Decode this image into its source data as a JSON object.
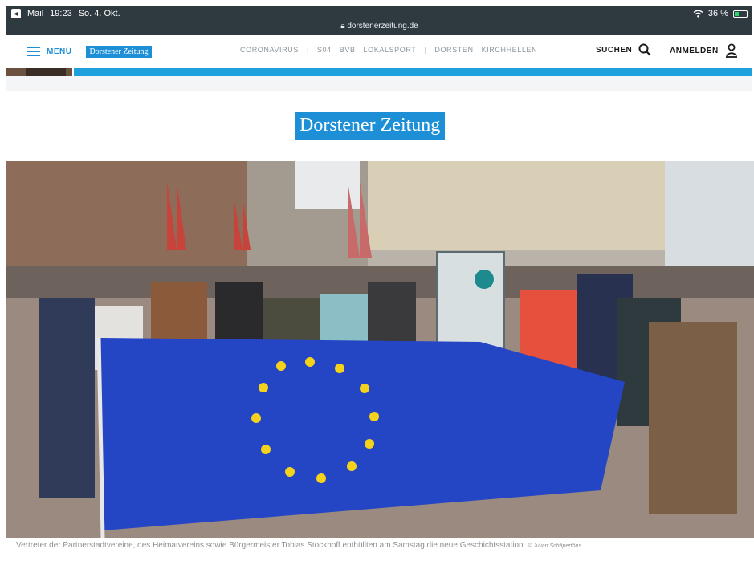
{
  "statusbar": {
    "app_back": "Mail",
    "time": "19:23",
    "date": "So. 4. Okt.",
    "url": "dorstenerzeitung.de",
    "battery": "36 %",
    "battery_level": 0.36
  },
  "navbar": {
    "menu_label": "MENÜ",
    "logo_small": "Dorstener Zeitung",
    "links": [
      "CORONAVIRUS",
      "S04",
      "BVB",
      "LOKALSPORT",
      "DORSTEN",
      "KIRCHHELLEN"
    ],
    "separator": "|",
    "search_label": "SUCHEN",
    "login_label": "ANMELDEN"
  },
  "masthead": {
    "title": "Dorstener Zeitung"
  },
  "article": {
    "caption": "Vertreter der Partnerstadtvereine, des Heimatvereins sowie Bürgermeister Tobias Stockhoff enthüllten am Samstag die neue Geschichtsstation.",
    "credit": "© Julian Schäpertöns"
  },
  "colors": {
    "brand_blue": "#1c8fd6",
    "statusbar_bg": "#2f3a40",
    "eu_blue": "#2546c4",
    "eu_star": "#f5d21b"
  }
}
